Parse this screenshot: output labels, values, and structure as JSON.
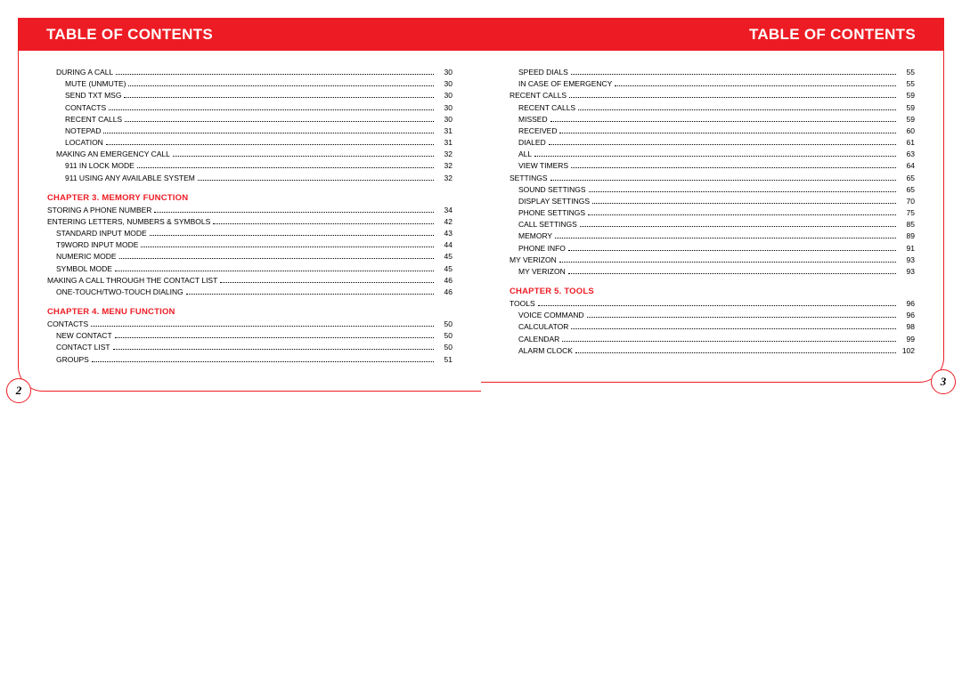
{
  "header": {
    "title": "TABLE OF CONTENTS"
  },
  "pageNumbers": {
    "left": "2",
    "right": "3"
  },
  "left": {
    "sections": [
      {
        "heading": null,
        "entries": [
          {
            "label": "DURING A CALL",
            "page": "30",
            "indent": 1
          },
          {
            "label": "MUTE (UNMUTE)",
            "page": "30",
            "indent": 2
          },
          {
            "label": "SEND TXT MSG",
            "page": "30",
            "indent": 2
          },
          {
            "label": "CONTACTS",
            "page": "30",
            "indent": 2
          },
          {
            "label": "RECENT CALLS",
            "page": "30",
            "indent": 2
          },
          {
            "label": "NOTEPAD",
            "page": "31",
            "indent": 2
          },
          {
            "label": "LOCATION",
            "page": "31",
            "indent": 2
          },
          {
            "label": "MAKING AN EMERGENCY CALL",
            "page": "32",
            "indent": 1
          },
          {
            "label": "911 IN LOCK MODE",
            "page": "32",
            "indent": 2
          },
          {
            "label": "911 USING ANY AVAILABLE SYSTEM",
            "page": "32",
            "indent": 2
          }
        ]
      },
      {
        "heading": "CHAPTER 3.  MEMORY FUNCTION",
        "entries": [
          {
            "label": "STORING A PHONE NUMBER",
            "page": "34",
            "indent": 0
          },
          {
            "label": "ENTERING LETTERS, NUMBERS & SYMBOLS",
            "page": "42",
            "indent": 0
          },
          {
            "label": "STANDARD INPUT MODE",
            "page": "43",
            "indent": 1
          },
          {
            "label": "T9WORD INPUT MODE",
            "page": "44",
            "indent": 1
          },
          {
            "label": "NUMERIC MODE",
            "page": "45",
            "indent": 1
          },
          {
            "label": "SYMBOL MODE",
            "page": "45",
            "indent": 1
          },
          {
            "label": "MAKING A CALL THROUGH THE CONTACT LIST",
            "page": "46",
            "indent": 0
          },
          {
            "label": "ONE-TOUCH/TWO-TOUCH DIALING",
            "page": "46",
            "indent": 1
          }
        ]
      },
      {
        "heading": "CHAPTER 4.  MENU FUNCTION",
        "entries": [
          {
            "label": "CONTACTS",
            "page": "50",
            "indent": 0
          },
          {
            "label": "NEW CONTACT",
            "page": "50",
            "indent": 1
          },
          {
            "label": "CONTACT LIST",
            "page": "50",
            "indent": 1
          },
          {
            "label": "GROUPS",
            "page": "51",
            "indent": 1
          }
        ]
      }
    ]
  },
  "right": {
    "sections": [
      {
        "heading": null,
        "entries": [
          {
            "label": "SPEED DIALS",
            "page": "55",
            "indent": 1
          },
          {
            "label": "IN CASE OF EMERGENCY",
            "page": "55",
            "indent": 1
          },
          {
            "label": "RECENT CALLS",
            "page": "59",
            "indent": 0
          },
          {
            "label": "RECENT CALLS",
            "page": "59",
            "indent": 1
          },
          {
            "label": "MISSED",
            "page": "59",
            "indent": 1
          },
          {
            "label": "RECEIVED",
            "page": "60",
            "indent": 1
          },
          {
            "label": "DIALED",
            "page": "61",
            "indent": 1
          },
          {
            "label": "ALL",
            "page": "63",
            "indent": 1
          },
          {
            "label": "VIEW TIMERS",
            "page": "64",
            "indent": 1
          },
          {
            "label": "SETTINGS",
            "page": "65",
            "indent": 0
          },
          {
            "label": "SOUND SETTINGS",
            "page": "65",
            "indent": 1
          },
          {
            "label": "DISPLAY SETTINGS",
            "page": "70",
            "indent": 1
          },
          {
            "label": "PHONE SETTINGS",
            "page": "75",
            "indent": 1
          },
          {
            "label": "CALL SETTINGS",
            "page": "85",
            "indent": 1
          },
          {
            "label": "MEMORY",
            "page": "89",
            "indent": 1
          },
          {
            "label": "PHONE INFO",
            "page": "91",
            "indent": 1
          },
          {
            "label": "MY VERIZON",
            "page": "93",
            "indent": 0
          },
          {
            "label": "MY VERIZON",
            "page": "93",
            "indent": 1
          }
        ]
      },
      {
        "heading": "CHAPTER 5.  TOOLS",
        "entries": [
          {
            "label": "TOOLS",
            "page": "96",
            "indent": 0
          },
          {
            "label": "VOICE COMMAND",
            "page": "96",
            "indent": 1
          },
          {
            "label": "CALCULATOR",
            "page": "98",
            "indent": 1
          },
          {
            "label": "CALENDAR",
            "page": "99",
            "indent": 1
          },
          {
            "label": "ALARM CLOCK",
            "page": "102",
            "indent": 1
          }
        ]
      }
    ]
  }
}
